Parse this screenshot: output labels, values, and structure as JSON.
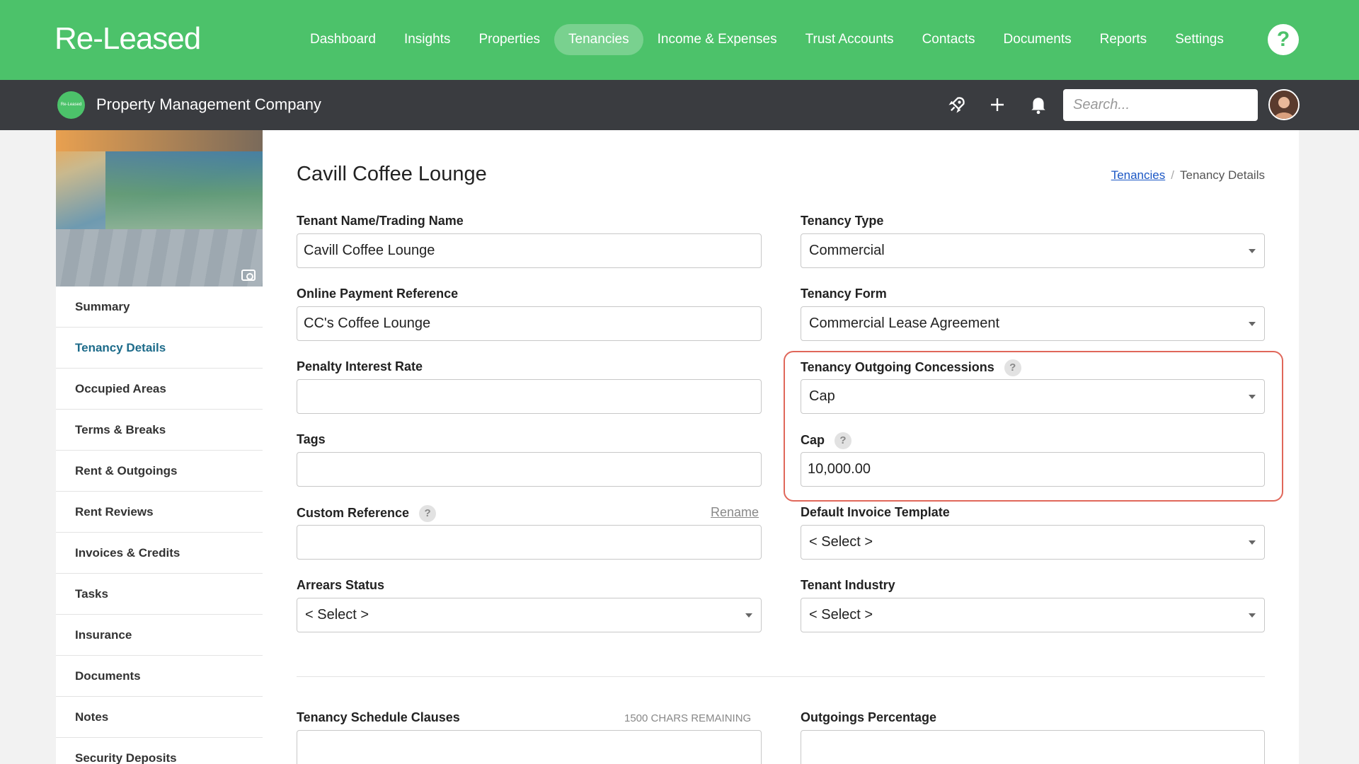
{
  "brand": {
    "logo_text": "Re-Leased",
    "accent": "#4cc26a",
    "dark_bar": "#3a3c40",
    "highlight": "#e0675a"
  },
  "nav": {
    "items": [
      "Dashboard",
      "Insights",
      "Properties",
      "Tenancies",
      "Income & Expenses",
      "Trust Accounts",
      "Contacts",
      "Documents",
      "Reports",
      "Settings"
    ],
    "active": "Tenancies",
    "help_label": "?"
  },
  "subbar": {
    "company_logo_text": "Re-Leased",
    "company_name": "Property Management Company",
    "icons": [
      "rocket-icon",
      "plus-icon",
      "bell-icon"
    ],
    "search_placeholder": "Search..."
  },
  "sidebar": {
    "items": [
      "Summary",
      "Tenancy Details",
      "Occupied Areas",
      "Terms & Breaks",
      "Rent & Outgoings",
      "Rent Reviews",
      "Invoices & Credits",
      "Tasks",
      "Insurance",
      "Documents",
      "Notes",
      "Security Deposits"
    ],
    "active": "Tenancy Details"
  },
  "page": {
    "title": "Cavill Coffee Lounge",
    "breadcrumb_link": "Tenancies",
    "breadcrumb_separator": "/",
    "breadcrumb_current": "Tenancy Details"
  },
  "form": {
    "tenant_name_label": "Tenant Name/Trading Name",
    "tenant_name_value": "Cavill Coffee Lounge",
    "online_ref_label": "Online Payment Reference",
    "online_ref_value": "CC's Coffee Lounge",
    "penalty_label": "Penalty Interest Rate",
    "penalty_value": "",
    "tags_label": "Tags",
    "tags_value": "",
    "custom_ref_label": "Custom Reference",
    "custom_ref_rename": "Rename",
    "custom_ref_value": "",
    "arrears_label": "Arrears Status",
    "arrears_value": "< Select >",
    "tenancy_type_label": "Tenancy Type",
    "tenancy_type_value": "Commercial",
    "tenancy_form_label": "Tenancy Form",
    "tenancy_form_value": "Commercial Lease Agreement",
    "concessions_label": "Tenancy Outgoing Concessions",
    "concessions_value": "Cap",
    "cap_label": "Cap",
    "cap_value": "10,000.00",
    "invoice_template_label": "Default Invoice Template",
    "invoice_template_value": "< Select >",
    "industry_label": "Tenant Industry",
    "industry_value": "< Select >",
    "schedule_clauses_label": "Tenancy Schedule Clauses",
    "schedule_chars_remaining": "1500 CHARS REMAINING",
    "outgoings_pct_label": "Outgoings Percentage",
    "help_mark": "?"
  }
}
